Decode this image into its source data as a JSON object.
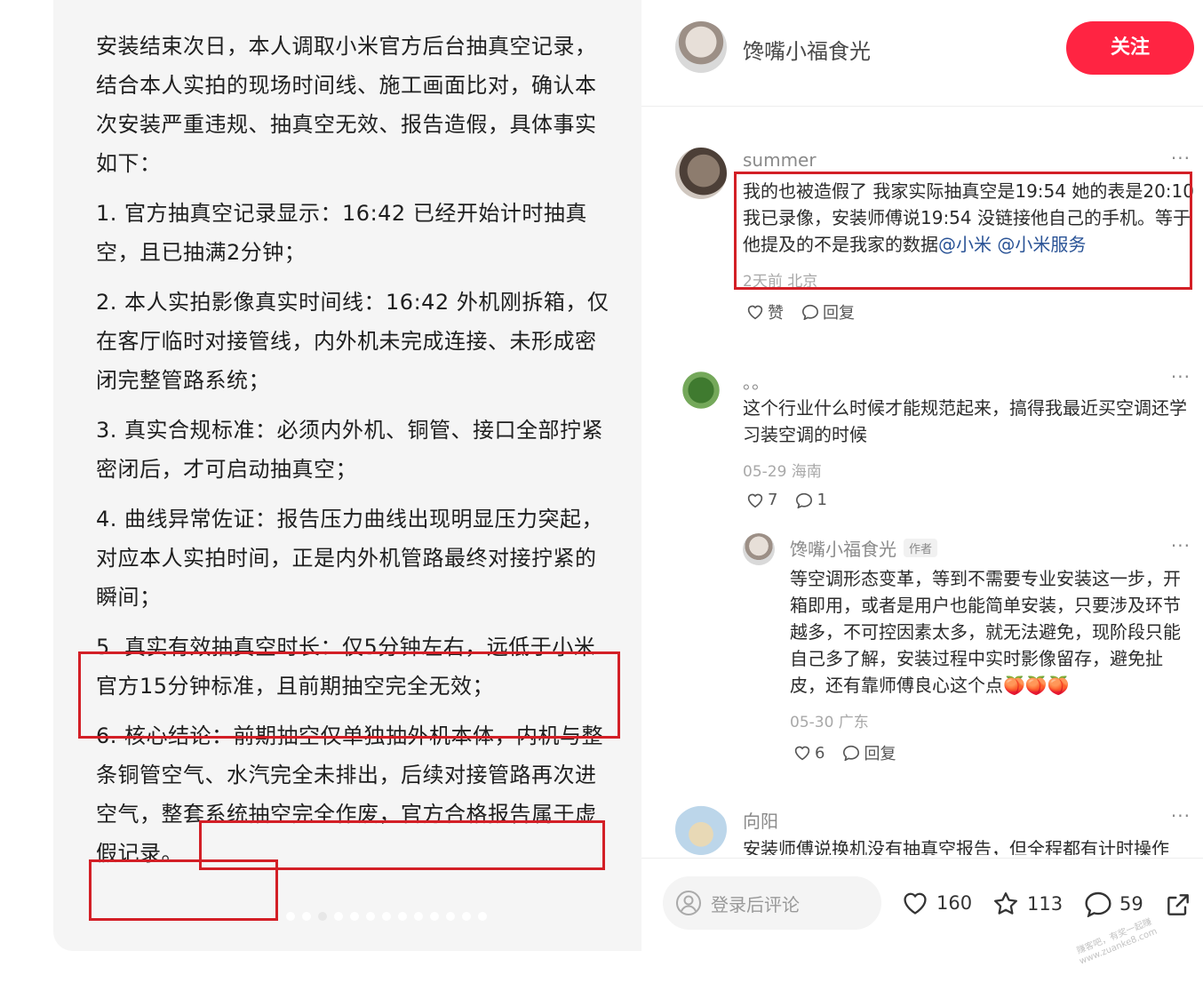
{
  "note": {
    "paragraphs": [
      "安装结束次日，本人调取小米官方后台抽真空记录，结合本人实拍的现场时间线、施工画面比对，确认本次安装严重违规、抽真空无效、报告造假，具体事实如下：",
      "1. 官方抽真空记录显示：16:42 已经开始计时抽真空，且已抽满2分钟；",
      "2. 本人实拍影像真实时间线：16:42 外机刚拆箱，仅在客厅临时对接管线，内外机未完成连接、未形成密闭完整管路系统；",
      "3. 真实合规标准：必须内外机、铜管、接口全部拧紧密闭后，才可启动抽真空；",
      "4. 曲线异常佐证：报告压力曲线出现明显压力突起，对应本人实拍时间，正是内外机管路最终对接拧紧的瞬间；",
      "5. 真实有效抽真空时长：仅5分钟左右，远低于小米官方15分钟标准，且前期抽空完全无效；",
      "6. 核心结论：前期抽空仅单独抽外机本体，内机与整条铜管空气、水汽完全未排出，后续对接管路再次进空气，整套系统抽空完全作废，官方合格报告属于虚假记录。"
    ]
  },
  "author": {
    "name": "馋嘴小福食光",
    "follow_label": "关注"
  },
  "comments": [
    {
      "name": "summer",
      "text_before": "我的也被造假了 我家实际抽真空是19:54 她的表是20:10 我已录像，安装师傅说19:54 没链接他自己的手机。等于他提及的不是我家的数据",
      "mention_1": "@小米",
      "mention_2": "@小米服务",
      "meta": "2天前 北京",
      "like_label": "赞",
      "reply_label": "回复"
    },
    {
      "name": "。。",
      "text": "这个行业什么时候才能规范起来，搞得我最近买空调还学习装空调的时候",
      "meta": "05-29 海南",
      "likes": "7",
      "replies": "1"
    },
    {
      "name": "馋嘴小福食光",
      "tag": "作者",
      "text": "等空调形态变革，等到不需要专业安装这一步，开箱即用，或者是用户也能简单安装，只要涉及环节越多，不可控因素太多，就无法避免，现阶段只能自己多了解，安装过程中实时影像留存，避免扯皮，还有靠师傅良心这个点🍑🍑🍑",
      "meta": "05-30 广东",
      "likes": "6",
      "reply_label": "回复"
    },
    {
      "name": "向阳",
      "text": "安装师傅说换机没有抽真空报告，但全程都有计时操作"
    }
  ],
  "more_label": "···",
  "bottom": {
    "input_placeholder": "登录后评论",
    "likes": "160",
    "stars": "113",
    "comments": "59"
  },
  "watermark": {
    "line1": "赚客吧，有奖一起赚",
    "line2": "www.zuanke8.com"
  },
  "colors": {
    "accent": "#ff2442",
    "highlight_box": "#d31f26",
    "mention": "#2a5396"
  },
  "icons": [
    "heart-icon",
    "star-icon",
    "comment-icon",
    "share-icon",
    "user-icon"
  ]
}
